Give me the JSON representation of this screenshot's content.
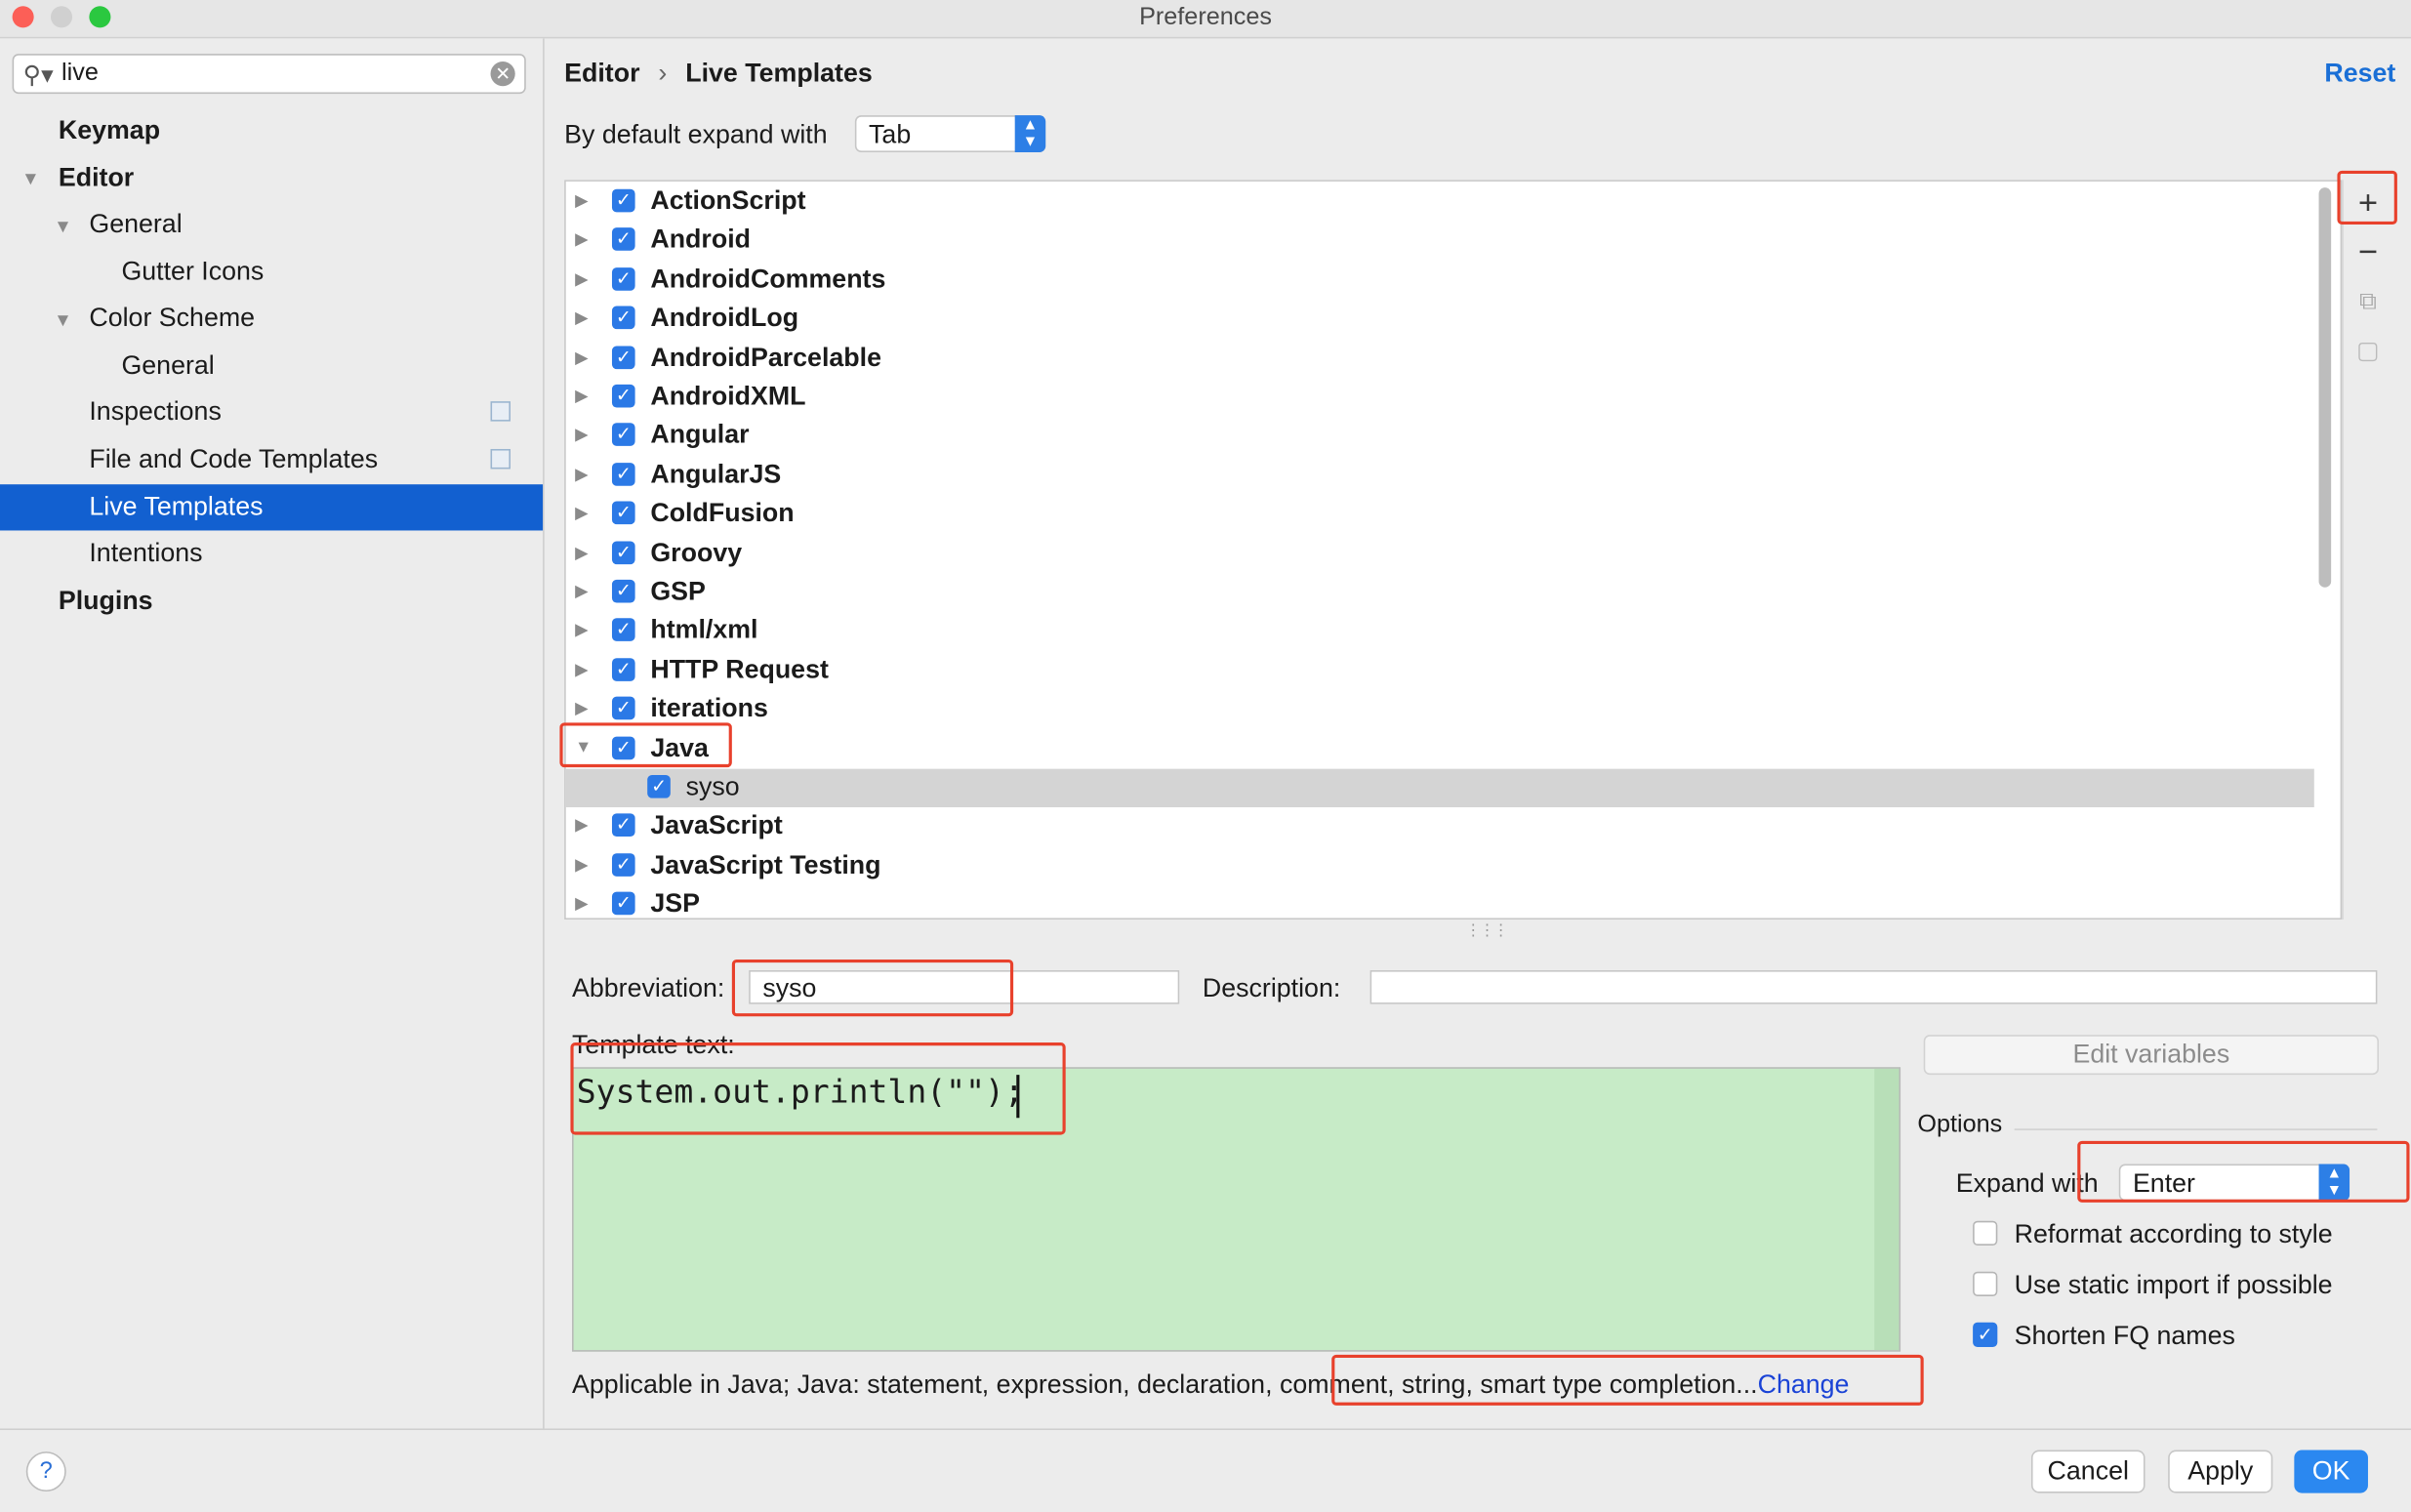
{
  "window": {
    "title": "Preferences"
  },
  "sidebar": {
    "search_value": "live",
    "items": [
      {
        "label": "Keymap"
      },
      {
        "label": "Editor"
      },
      {
        "label": "General"
      },
      {
        "label": "Gutter Icons"
      },
      {
        "label": "Color Scheme"
      },
      {
        "label": "General"
      },
      {
        "label": "Inspections"
      },
      {
        "label": "File and Code Templates"
      },
      {
        "label": "Live Templates"
      },
      {
        "label": "Intentions"
      },
      {
        "label": "Plugins"
      }
    ]
  },
  "header": {
    "breadcrumb_parent": "Editor",
    "breadcrumb_sep": "›",
    "breadcrumb_current": "Live Templates",
    "reset_label": "Reset"
  },
  "expand": {
    "label": "By default expand with",
    "value": "Tab"
  },
  "templates": {
    "groups": [
      "ActionScript",
      "Android",
      "AndroidComments",
      "AndroidLog",
      "AndroidParcelable",
      "AndroidXML",
      "Angular",
      "AngularJS",
      "ColdFusion",
      "Groovy",
      "GSP",
      "html/xml",
      "HTTP Request",
      "iterations",
      "Java",
      "syso",
      "JavaScript",
      "JavaScript Testing",
      "JSP"
    ]
  },
  "editor": {
    "abbreviation_label": "Abbreviation:",
    "abbreviation_value": "syso",
    "description_label": "Description:",
    "description_value": "",
    "template_text_label": "Template text:",
    "template_text": "System.out.println(\"\");",
    "edit_variables_label": "Edit variables",
    "applicable_text": "Applicable in Java; Java: statement, expression, declaration, comment, string, smart type completion...",
    "change_label": "Change"
  },
  "options": {
    "title": "Options",
    "expand_with_label": "Expand with",
    "expand_with_value": "Enter",
    "reformat_label": "Reformat according to style",
    "static_import_label": "Use static import if possible",
    "shorten_label": "Shorten FQ names",
    "reformat_checked": false,
    "static_import_checked": false,
    "shorten_checked": true
  },
  "buttons": {
    "cancel": "Cancel",
    "apply": "Apply",
    "ok": "OK",
    "help": "?"
  },
  "colors": {
    "accent": "#2b79e6",
    "selection": "#1260d0",
    "highlight": "#e8412c",
    "template_bg": "#c7ebc7"
  }
}
